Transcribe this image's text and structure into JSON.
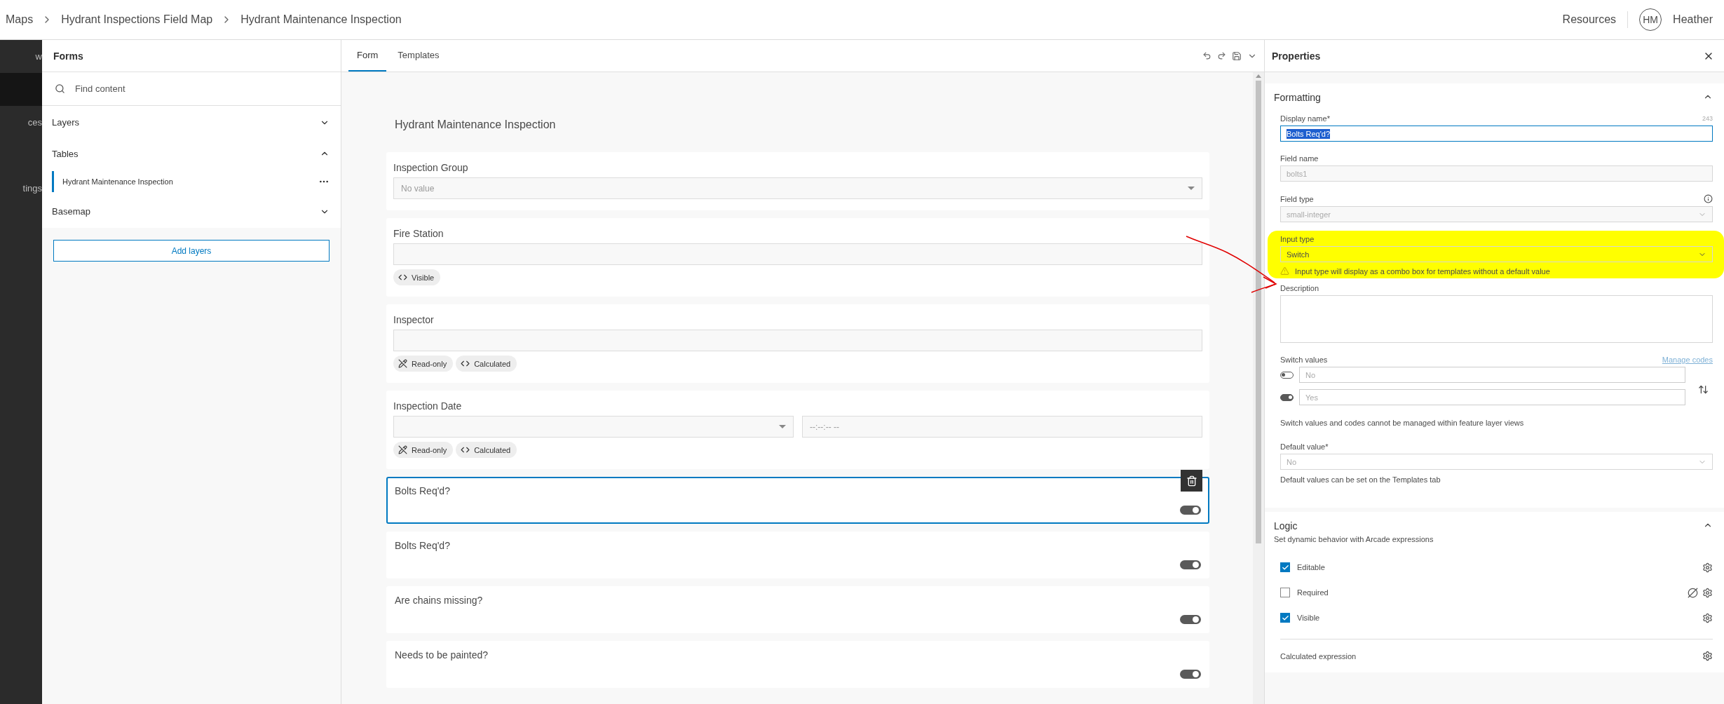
{
  "breadcrumb": [
    "Maps",
    "Hydrant Inspections Field Map",
    "Hydrant Maintenance Inspection"
  ],
  "header": {
    "resources": "Resources",
    "avatar": "HM",
    "user": "Heather"
  },
  "nav_rail": [
    {
      "label": "w",
      "selected": false
    },
    {
      "selected": true
    },
    {
      "label": "ces",
      "selected": false
    },
    {
      "label": "tings",
      "selected": false
    }
  ],
  "forms_panel": {
    "title": "Forms",
    "search": {
      "placeholder": "Find content"
    },
    "groups": [
      {
        "label": "Layers",
        "expanded": false
      },
      {
        "label": "Tables",
        "expanded": true,
        "children": [
          {
            "label": "Hydrant Maintenance Inspection",
            "selected": true
          }
        ]
      },
      {
        "label": "Basemap",
        "expanded": false
      }
    ],
    "add_button": "Add layers"
  },
  "editor": {
    "tabs": [
      {
        "label": "Form",
        "selected": true
      },
      {
        "label": "Templates",
        "selected": false
      }
    ],
    "form_title": "Hydrant Maintenance Inspection",
    "elements": [
      {
        "kind": "combo",
        "label": "Inspection Group",
        "placeholder": "No value",
        "selected": false
      },
      {
        "kind": "text",
        "label": "Fire Station",
        "selected": false,
        "badges": [
          {
            "kind": "code",
            "label": "Visible"
          }
        ]
      },
      {
        "kind": "text",
        "label": "Inspector",
        "selected": false,
        "badges": [
          {
            "kind": "readonly",
            "label": "Read-only"
          },
          {
            "kind": "code",
            "label": "Calculated"
          }
        ]
      },
      {
        "kind": "datetime",
        "label": "Inspection Date",
        "time_placeholder": "--:--:-- --",
        "selected": false,
        "badges": [
          {
            "kind": "readonly",
            "label": "Read-only"
          },
          {
            "kind": "code",
            "label": "Calculated"
          }
        ]
      },
      {
        "kind": "switch",
        "label": "Bolts Req'd?",
        "on": true,
        "selected": true
      },
      {
        "kind": "switch",
        "label": "Bolts Req'd?",
        "on": true,
        "selected": false
      },
      {
        "kind": "switch",
        "label": "Are chains missing?",
        "on": true,
        "selected": false
      },
      {
        "kind": "switch",
        "label": "Needs to be painted?",
        "on": true,
        "selected": false
      }
    ]
  },
  "properties": {
    "title": "Properties",
    "formatting": {
      "title": "Formatting",
      "expanded": true,
      "display_name": {
        "label": "Display name*",
        "count": "243",
        "value": "Bolts Req'd?"
      },
      "field_name": {
        "label": "Field name",
        "value": "bolts1",
        "disabled": true
      },
      "field_type": {
        "label": "Field type",
        "value": "small-integer",
        "disabled": true
      },
      "input_type": {
        "label": "Input type",
        "value": "Switch",
        "warning": "Input type will display as a combo box for templates without a default value"
      },
      "description": {
        "label": "Description"
      },
      "switch_values": {
        "label": "Switch values",
        "link": "Manage codes",
        "off_placeholder": "No",
        "on_placeholder": "Yes",
        "note": "Switch values and codes cannot be managed within feature layer views"
      },
      "default_value": {
        "label": "Default value*",
        "value": "No",
        "disabled": true,
        "note": "Default values can be set on the Templates tab"
      }
    },
    "logic": {
      "title": "Logic",
      "subtitle": "Set dynamic behavior with Arcade expressions",
      "expanded": true,
      "rules": [
        {
          "label": "Editable",
          "checked": true,
          "clearable": false
        },
        {
          "label": "Required",
          "checked": false,
          "clearable": true
        },
        {
          "label": "Visible",
          "checked": true,
          "clearable": false
        }
      ],
      "calculated": "Calculated expression"
    }
  }
}
